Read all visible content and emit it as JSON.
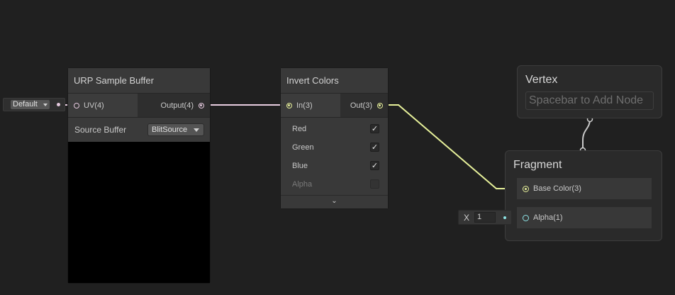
{
  "uv_input": {
    "default_label": "Default"
  },
  "urp_node": {
    "title": "URP Sample Buffer",
    "input_port": "UV(4)",
    "output_port": "Output(4)",
    "source_label": "Source Buffer",
    "source_value": "BlitSource"
  },
  "invert_node": {
    "title": "Invert Colors",
    "input_port": "In(3)",
    "output_port": "Out(3)",
    "options": [
      {
        "label": "Red",
        "checked": true,
        "enabled": true
      },
      {
        "label": "Green",
        "checked": true,
        "enabled": true
      },
      {
        "label": "Blue",
        "checked": true,
        "enabled": true
      },
      {
        "label": "Alpha",
        "checked": false,
        "enabled": false
      }
    ],
    "expand_glyph": "⌄"
  },
  "vertex_context": {
    "title": "Vertex",
    "placeholder": "Spacebar to Add Node"
  },
  "fragment_context": {
    "title": "Fragment",
    "blocks": [
      {
        "label": "Base Color(3)"
      },
      {
        "label": "Alpha(1)"
      }
    ]
  },
  "alpha_input": {
    "axis": "X",
    "value": "1"
  },
  "colors": {
    "canvas": "#202020",
    "uv_wire": "#e8cde0",
    "color3_wire": "#e7f19a",
    "float_wire": "#84e4e7",
    "port_uv": "#e5c9de",
    "port_color3": "#e6ef9a",
    "port_float": "#8ee4e6"
  }
}
